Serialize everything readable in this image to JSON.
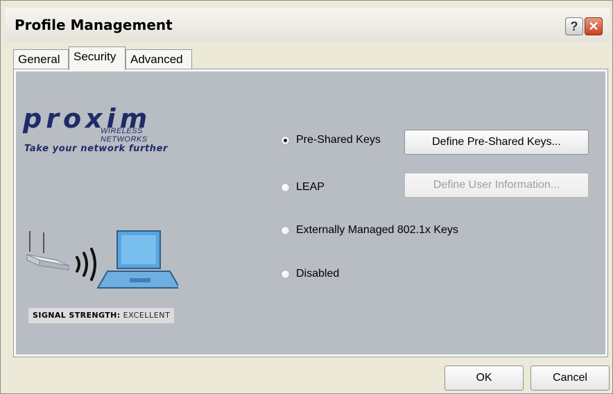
{
  "window": {
    "title": "Profile Management",
    "help_button": "?",
    "close_button": "✕"
  },
  "tabs": [
    {
      "label": "General",
      "active": false
    },
    {
      "label": "Security",
      "active": true
    },
    {
      "label": "Advanced",
      "active": false
    }
  ],
  "branding": {
    "logo_text": "proxim",
    "logo_subtitle": "WIRELESS NETWORKS",
    "tagline": "Take your network further",
    "brand_color": "#1f2a68"
  },
  "signal": {
    "label": "SIGNAL STRENGTH:",
    "value": "EXCELLENT"
  },
  "security_options": [
    {
      "label": "Pre-Shared Keys",
      "selected": true
    },
    {
      "label": "LEAP",
      "selected": false
    },
    {
      "label": "Externally Managed 802.1x Keys",
      "selected": false
    },
    {
      "label": "Disabled",
      "selected": false
    }
  ],
  "buttons": {
    "define_psk": "Define Pre-Shared Keys...",
    "define_user": "Define User Information...",
    "ok": "OK",
    "cancel": "Cancel"
  },
  "colors": {
    "panel_background": "#b8bcc3",
    "close_button": "#c9401d"
  }
}
